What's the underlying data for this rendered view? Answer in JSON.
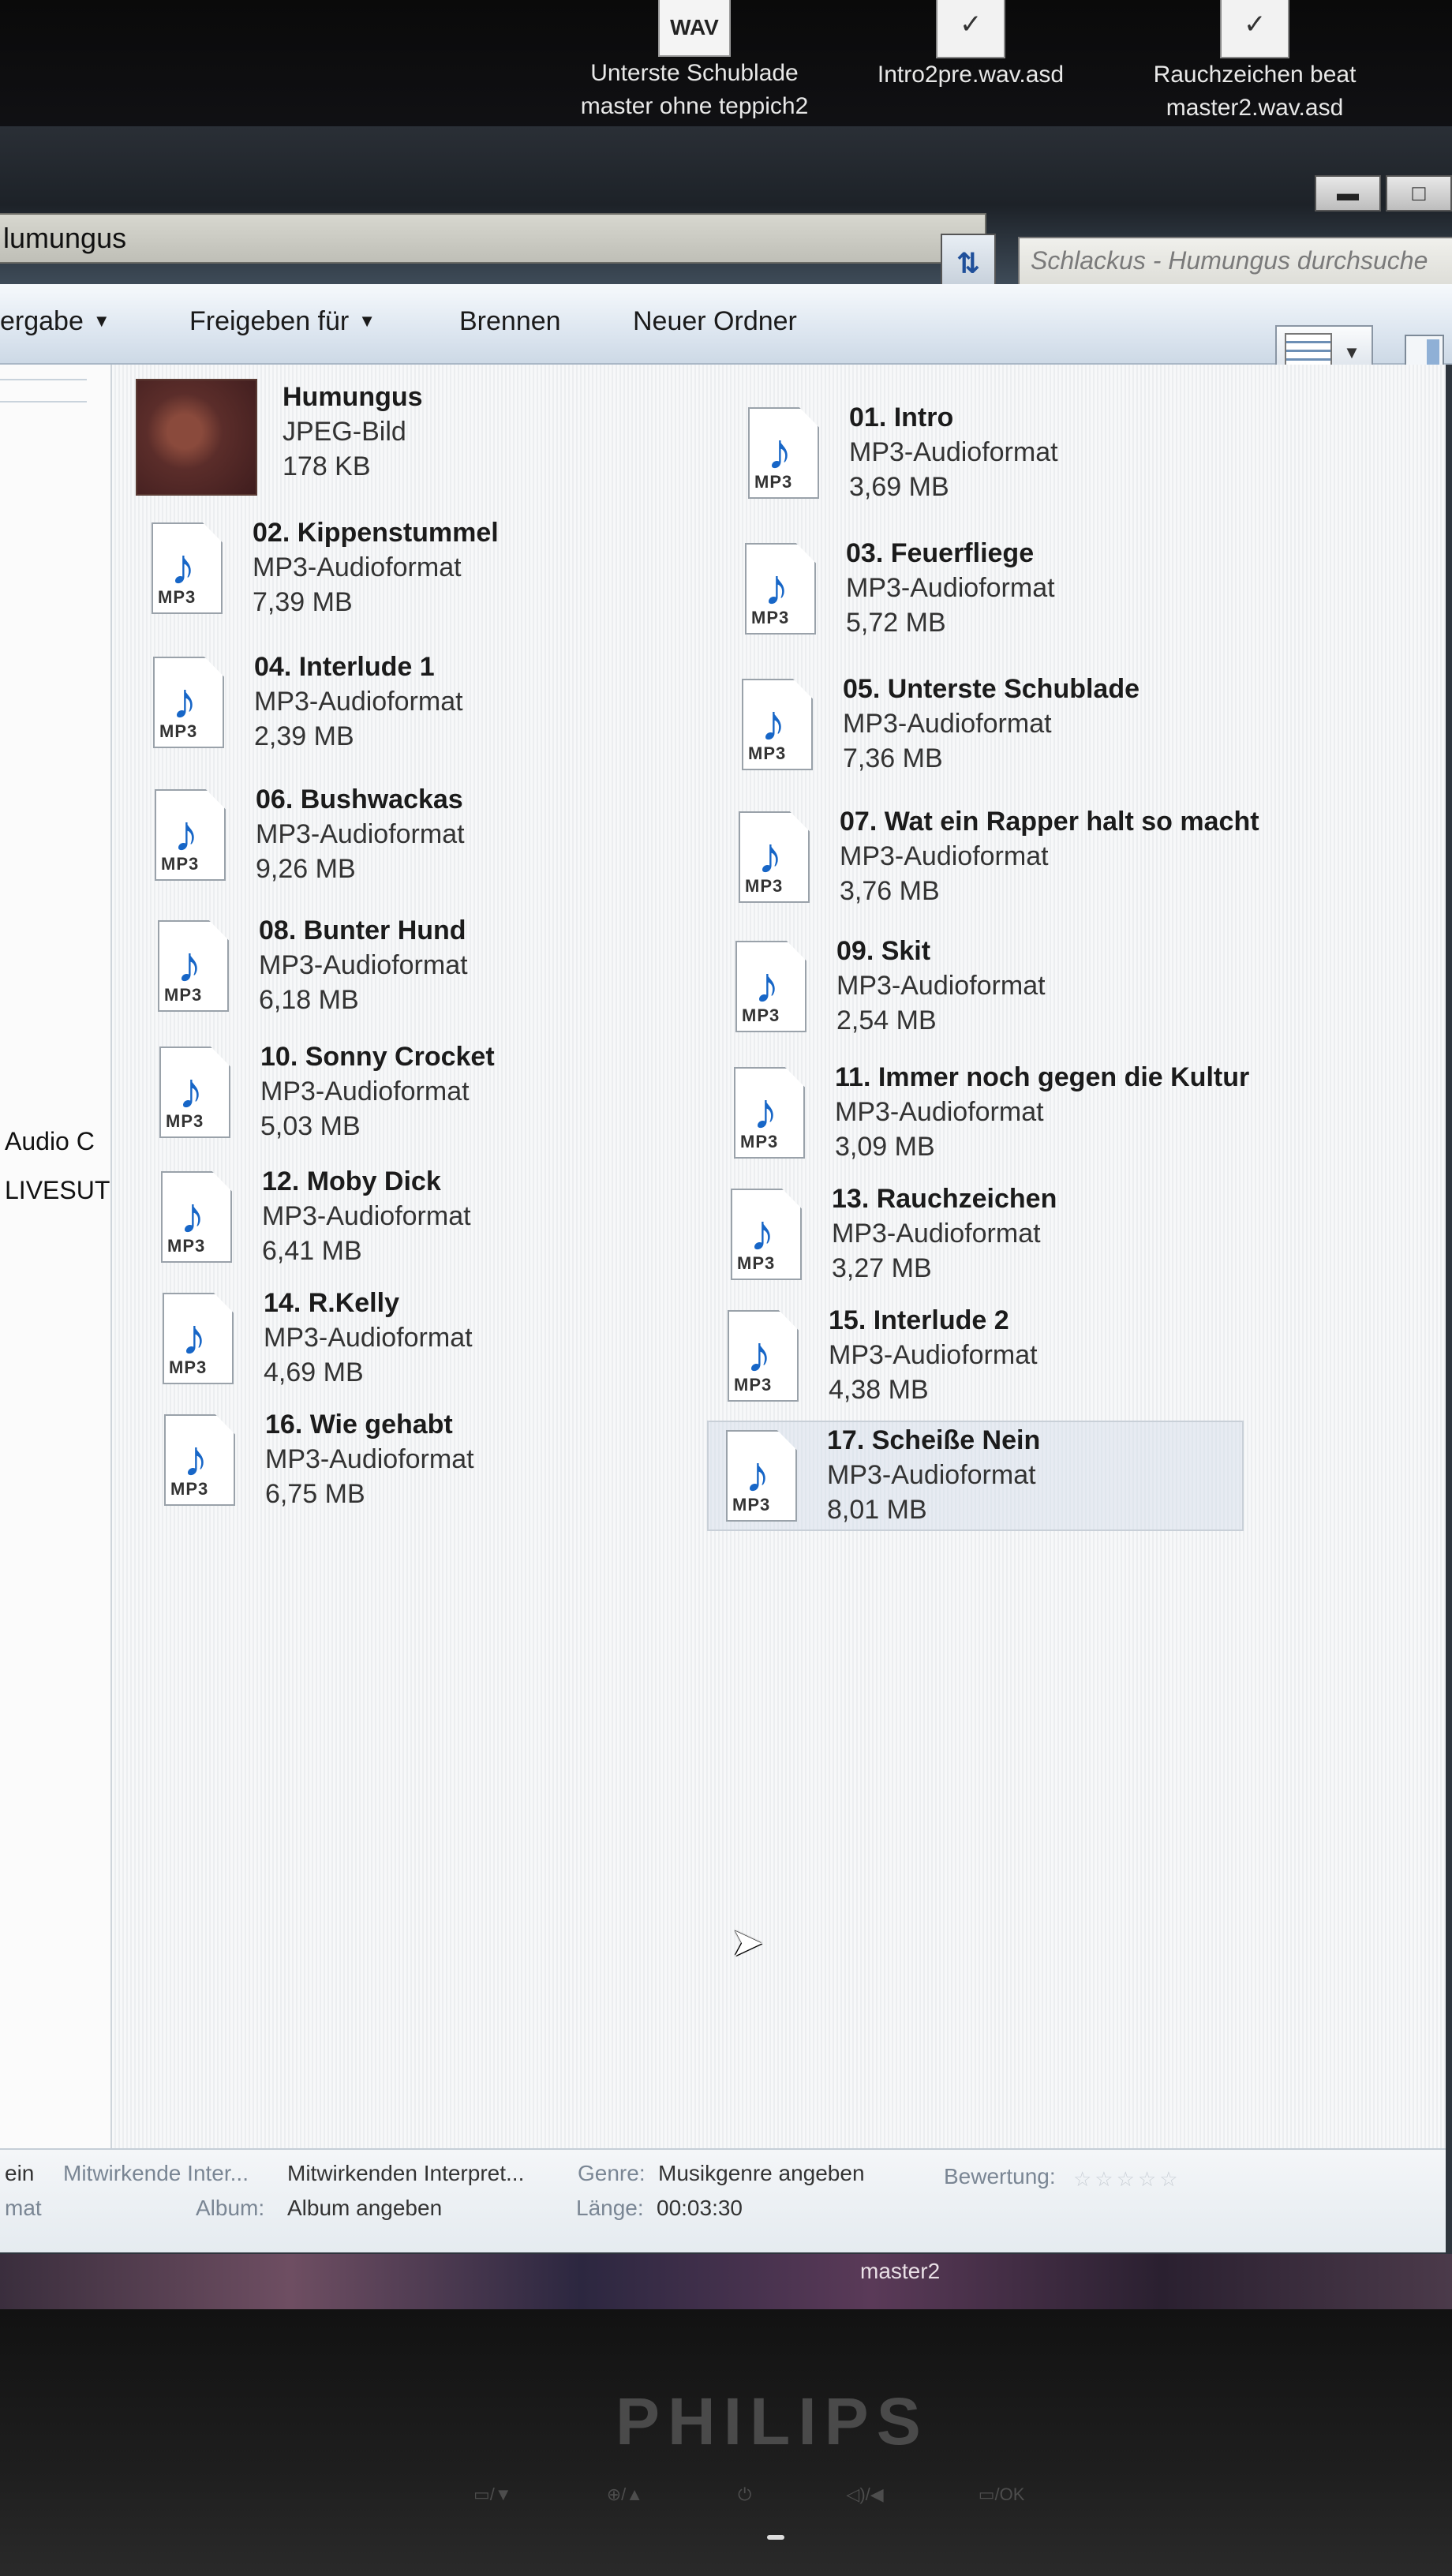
{
  "desktop": {
    "icons": [
      {
        "badge": "WAV",
        "line1": "Unterste Schublade",
        "line2": "master ohne teppich2"
      },
      {
        "badge": "",
        "line1": "Intro2pre.wav.asd",
        "line2": ""
      },
      {
        "badge": "",
        "line1": "Rauchzeichen beat",
        "line2": "master2.wav.asd"
      }
    ]
  },
  "window": {
    "address": "lumungus",
    "search_placeholder": "Schlackus - Humungus durchsuche",
    "controls": {
      "minimize": "▬",
      "maximize": "□"
    }
  },
  "toolbar": {
    "wiedergabe": "ergabe",
    "share": "Freigeben für",
    "burn": "Brennen",
    "new_folder": "Neuer Ordner"
  },
  "nav": {
    "item1": "Audio C",
    "item2": "LIVESUT"
  },
  "files": [
    {
      "name": "Humungus",
      "type": "JPEG-Bild",
      "size": "178 KB"
    },
    {
      "name": "01. Intro",
      "type": "MP3-Audioformat",
      "size": "3,69 MB"
    },
    {
      "name": "02. Kippenstummel",
      "type": "MP3-Audioformat",
      "size": "7,39 MB"
    },
    {
      "name": "03. Feuerfliege",
      "type": "MP3-Audioformat",
      "size": "5,72 MB"
    },
    {
      "name": "04. Interlude 1",
      "type": "MP3-Audioformat",
      "size": "2,39 MB"
    },
    {
      "name": "05. Unterste Schublade",
      "type": "MP3-Audioformat",
      "size": "7,36 MB"
    },
    {
      "name": "06. Bushwackas",
      "type": "MP3-Audioformat",
      "size": "9,26 MB"
    },
    {
      "name": "07. Wat ein Rapper halt so macht",
      "type": "MP3-Audioformat",
      "size": "3,76 MB"
    },
    {
      "name": "08. Bunter Hund",
      "type": "MP3-Audioformat",
      "size": "6,18 MB"
    },
    {
      "name": "09. Skit",
      "type": "MP3-Audioformat",
      "size": "2,54 MB"
    },
    {
      "name": "10. Sonny Crocket",
      "type": "MP3-Audioformat",
      "size": "5,03 MB"
    },
    {
      "name": "11. Immer noch gegen die Kultur",
      "type": "MP3-Audioformat",
      "size": "3,09 MB"
    },
    {
      "name": "12. Moby Dick",
      "type": "MP3-Audioformat",
      "size": "6,41 MB"
    },
    {
      "name": "13. Rauchzeichen",
      "type": "MP3-Audioformat",
      "size": "3,27 MB"
    },
    {
      "name": "14. R.Kelly",
      "type": "MP3-Audioformat",
      "size": "4,69 MB"
    },
    {
      "name": "15. Interlude 2",
      "type": "MP3-Audioformat",
      "size": "4,38 MB"
    },
    {
      "name": "16. Wie gehabt",
      "type": "MP3-Audioformat",
      "size": "6,75 MB"
    },
    {
      "name": "17. Scheiße Nein",
      "type": "MP3-Audioformat",
      "size": "8,01 MB"
    }
  ],
  "file_icon_tag": "MP3",
  "details": {
    "col0_line1": "ein",
    "col0_line2": "mat",
    "contrib_key": "Mitwirkende Inter...",
    "contrib_val": "Mitwirkenden Interpret...",
    "album_key": "Album:",
    "album_val": "Album angeben",
    "genre_key": "Genre:",
    "genre_val": "Musikgenre angeben",
    "length_key": "Länge:",
    "length_val": "00:03:30",
    "rating_key": "Bewertung:",
    "rating_stars": "☆☆☆☆☆"
  },
  "taskbar": {
    "label": "master2"
  },
  "monitor": {
    "brand": "PHILIPS",
    "buttons": [
      "▭/▼",
      "⊕/▲",
      "⏻",
      "◁)/◀",
      "▭/OK"
    ]
  }
}
